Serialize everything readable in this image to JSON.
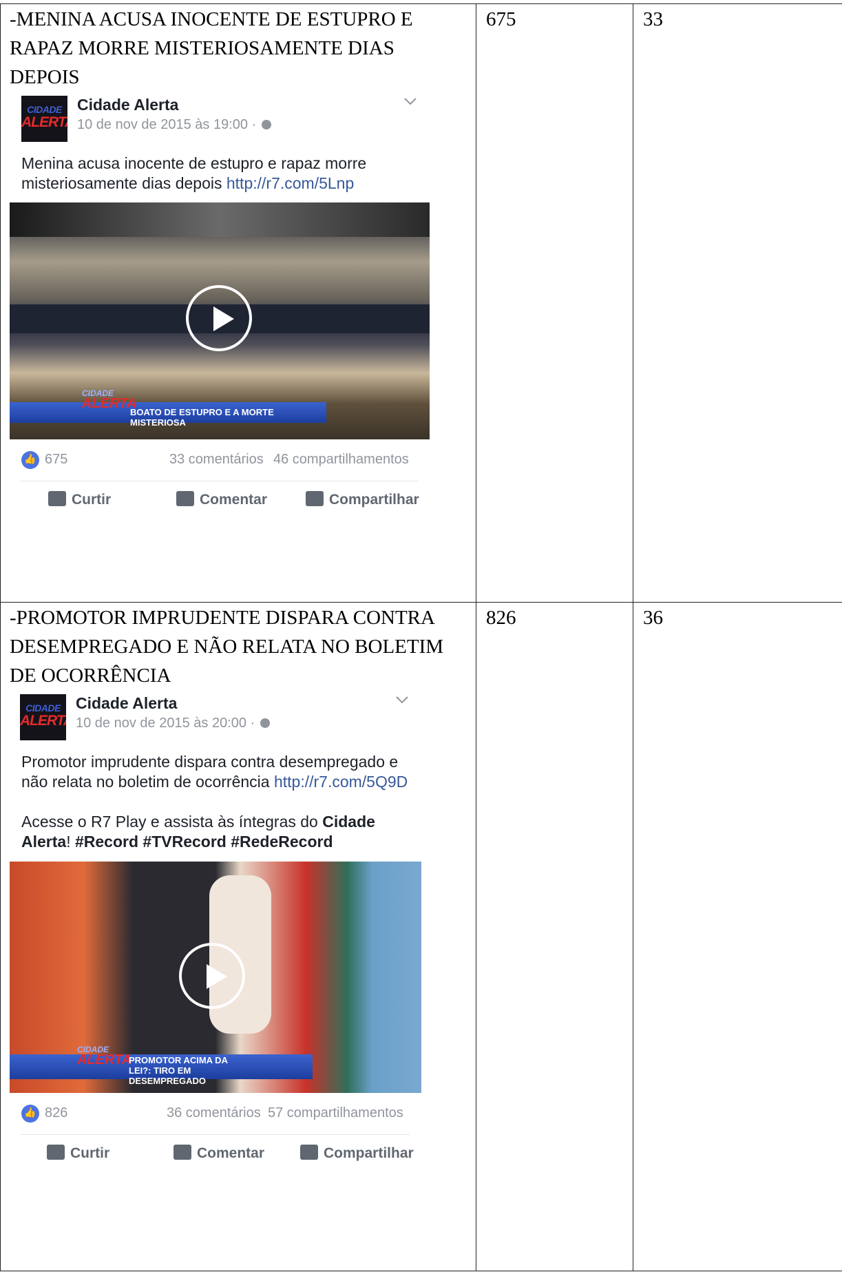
{
  "rows": [
    {
      "headline": "-MENINA ACUSA INOCENTE DE ESTUPRO E RAPAZ MORRE MISTERIOSAMENTE DIAS DEPOIS",
      "likes_col": "675",
      "comments_col": "33",
      "post": {
        "logo_top": "CIDADE",
        "logo_bottom": "ALERTA",
        "page_name": "Cidade Alerta",
        "date": "10 de nov de 2015 às 19:00 ·",
        "text": "Menina acusa inocente de estupro e rapaz morre misteriosamente dias depois ",
        "link": "http://r7.com/5Lnp",
        "banner": "BOATO DE ESTUPRO E A MORTE MISTERIOSA",
        "banner_logo": "ALERTA",
        "banner_logo_small": "CIDADE",
        "likes": "675",
        "comments": "33 comentários",
        "shares": "46 compartilhamentos",
        "action_like": "Curtir",
        "action_comment": "Comentar",
        "action_share": "Compartilhar"
      }
    },
    {
      "headline": "-PROMOTOR IMPRUDENTE DISPARA CONTRA DESEMPREGADO E NÃO RELATA NO BOLETIM DE OCORRÊNCIA",
      "likes_col": "826",
      "comments_col": "36",
      "post": {
        "logo_top": "CIDADE",
        "logo_bottom": "ALERTA",
        "page_name": "Cidade Alerta",
        "date": "10 de nov de 2015 às 20:00 ·",
        "text": "Promotor imprudente dispara contra desempregado e não relata no boletim de ocorrência ",
        "link": "http://r7.com/5Q9D",
        "text2_a": "Acesse o R7 Play e assista às íntegras do ",
        "text2_b": "Cidade Alerta",
        "text2_c": "! ",
        "text2_tags": "#Record #TVRecord #RedeRecord",
        "banner": "PROMOTOR ACIMA DA LEI?: TIRO EM DESEMPREGADO",
        "banner_logo": "ALERTA",
        "banner_logo_small": "CIDADE",
        "likes": "826",
        "comments": "36 comentários",
        "shares": "57 compartilhamentos",
        "action_like": "Curtir",
        "action_comment": "Comentar",
        "action_share": "Compartilhar"
      }
    }
  ]
}
